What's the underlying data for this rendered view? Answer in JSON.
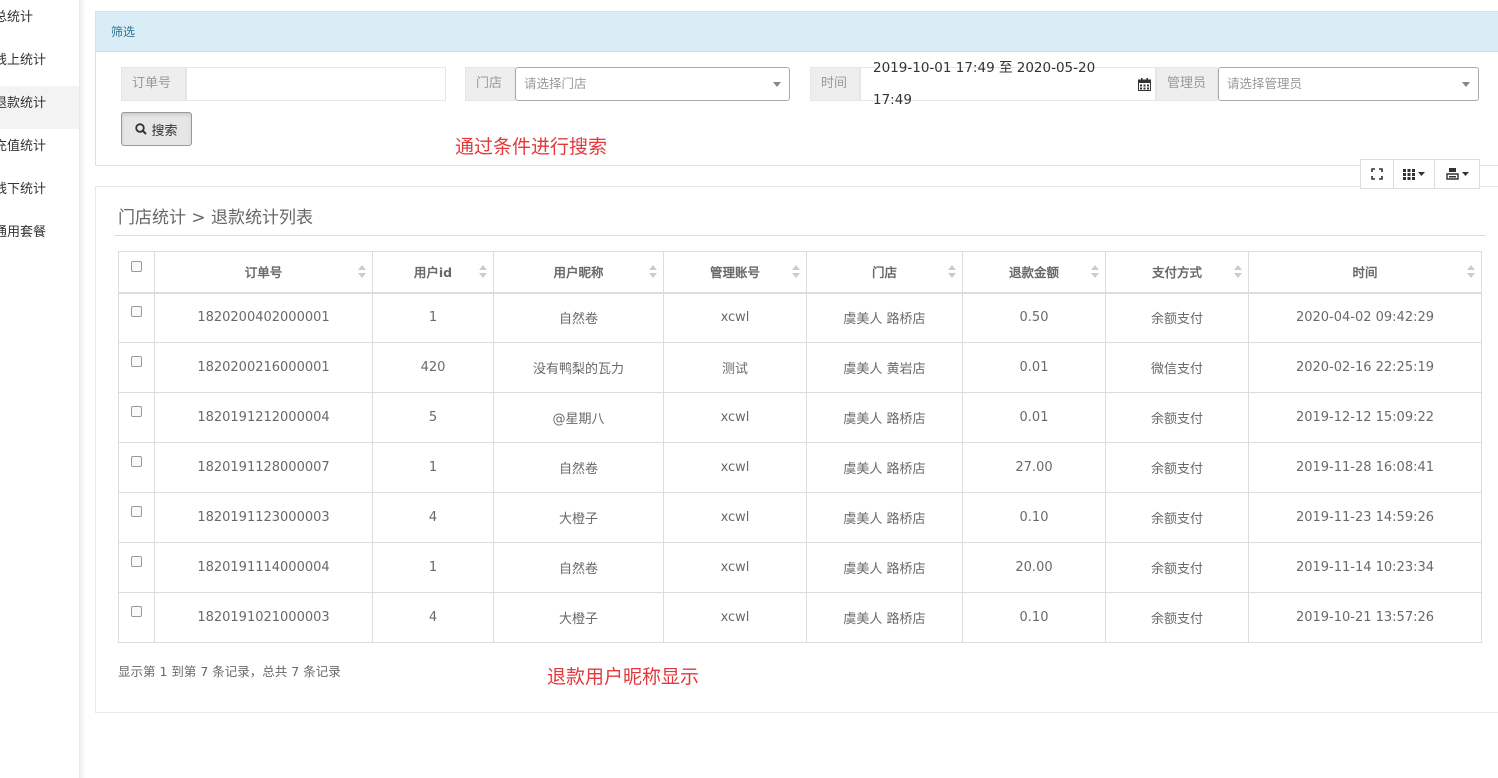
{
  "sidebar": {
    "items": [
      {
        "label": "总统计",
        "active": false
      },
      {
        "label": "线上统计",
        "active": false
      },
      {
        "label": "退款统计",
        "active": true
      },
      {
        "label": "充值统计",
        "active": false
      },
      {
        "label": "线下统计",
        "active": false
      },
      {
        "label": "通用套餐",
        "active": false
      }
    ]
  },
  "filter": {
    "title": "筛选",
    "order_label": "订单号",
    "order_value": "",
    "store_label": "门店",
    "store_placeholder": "请选择门店",
    "time_label": "时间",
    "time_value": "2019-10-01 17:49 至 2020-05-20 17:49",
    "admin_label": "管理员",
    "admin_placeholder": "请选择管理员",
    "search_label": "搜索"
  },
  "annotations": {
    "search_note": "通过条件进行搜索",
    "nickname_note": "退款用户昵称显示"
  },
  "list": {
    "breadcrumb": "门店统计 > 退款统计列表",
    "columns": [
      "订单号",
      "用户id",
      "用户昵称",
      "管理账号",
      "门店",
      "退款金额",
      "支付方式",
      "时间"
    ],
    "rows": [
      [
        "1820200402000001",
        "1",
        "自然卷",
        "xcwl",
        "虞美人 路桥店",
        "0.50",
        "余额支付",
        "2020-04-02 09:42:29"
      ],
      [
        "1820200216000001",
        "420",
        "没有鸭梨的瓦力",
        "测试",
        "虞美人 黄岩店",
        "0.01",
        "微信支付",
        "2020-02-16 22:25:19"
      ],
      [
        "1820191212000004",
        "5",
        "@星期八",
        "xcwl",
        "虞美人 路桥店",
        "0.01",
        "余额支付",
        "2019-12-12 15:09:22"
      ],
      [
        "1820191128000007",
        "1",
        "自然卷",
        "xcwl",
        "虞美人 路桥店",
        "27.00",
        "余额支付",
        "2019-11-28 16:08:41"
      ],
      [
        "1820191123000003",
        "4",
        "大橙子",
        "xcwl",
        "虞美人 路桥店",
        "0.10",
        "余额支付",
        "2019-11-23 14:59:26"
      ],
      [
        "1820191114000004",
        "1",
        "自然卷",
        "xcwl",
        "虞美人 路桥店",
        "20.00",
        "余额支付",
        "2019-11-14 10:23:34"
      ],
      [
        "1820191021000003",
        "4",
        "大橙子",
        "xcwl",
        "虞美人 路桥店",
        "0.10",
        "余额支付",
        "2019-10-21 13:57:26"
      ]
    ],
    "pagination_info": "显示第 1 到第 7 条记录，总共 7 条记录"
  },
  "toolbar": {
    "icons": [
      "fullscreen-icon",
      "columns-icon",
      "export-icon"
    ]
  },
  "colors": {
    "filter_header_bg": "#d9edf7",
    "annotation_red": "#e4393c"
  }
}
